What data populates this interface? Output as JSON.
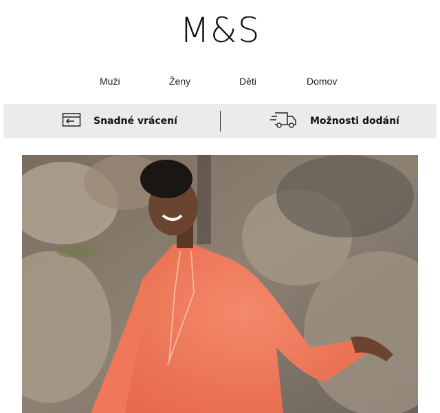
{
  "brand": {
    "logo_text": "M&S"
  },
  "nav": {
    "items": [
      {
        "label": "Muži"
      },
      {
        "label": "Ženy"
      },
      {
        "label": "Děti"
      },
      {
        "label": "Domov"
      }
    ]
  },
  "services": {
    "returns_label": "Snadné vrácení",
    "returns_icon": "return-box-icon",
    "delivery_label": "Možnosti dodání",
    "delivery_icon": "delivery-truck-icon"
  },
  "hero": {
    "image": "hero-image",
    "colors": {
      "dress": "#f07a5c",
      "rocks": "#9a8f84",
      "background": "#6f655c"
    }
  }
}
